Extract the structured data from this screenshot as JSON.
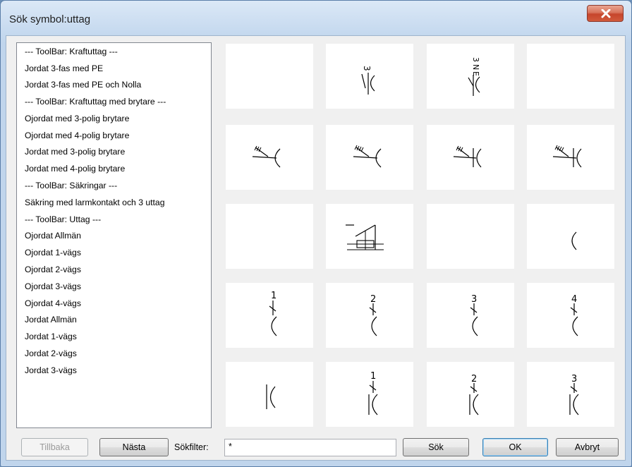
{
  "window": {
    "title": "Sök symbol:uttag"
  },
  "list": {
    "items": [
      "--- ToolBar: Kraftuttag ---",
      "Jordat 3-fas med PE",
      "Jordat 3-fas med PE och Nolla",
      "--- ToolBar: Kraftuttag med brytare ---",
      "Ojordat med 3-polig brytare",
      "Ojordat med 4-polig brytare",
      "Jordat med 3-polig brytare",
      "Jordat med 4-polig brytare",
      "--- ToolBar: Säkringar ---",
      "Säkring med larmkontakt och 3 uttag",
      "--- ToolBar: Uttag ---",
      "Ojordat Allmän",
      "Ojordat 1-vägs",
      "Ojordat 2-vägs",
      "Ojordat 3-vägs",
      "Ojordat 4-vägs",
      "Jordat Allmän",
      "Jordat 1-vägs",
      "Jordat 2-vägs",
      "Jordat 3-vägs"
    ]
  },
  "symbols": {
    "row1": {
      "label_3fas": "3",
      "label_3nepe": "3",
      "label_ne_n": "N",
      "label_ne_e": "E"
    },
    "row4": {
      "n1": "1",
      "n2": "2",
      "n3": "3",
      "n4": "4"
    },
    "row5": {
      "n1": "1",
      "n2": "2",
      "n3": "3"
    }
  },
  "footer": {
    "back_label": "Tillbaka",
    "next_label": "Nästa",
    "filter_label": "Sökfilter:",
    "filter_value": "*",
    "search_label": "Sök",
    "ok_label": "OK",
    "cancel_label": "Avbryt"
  }
}
